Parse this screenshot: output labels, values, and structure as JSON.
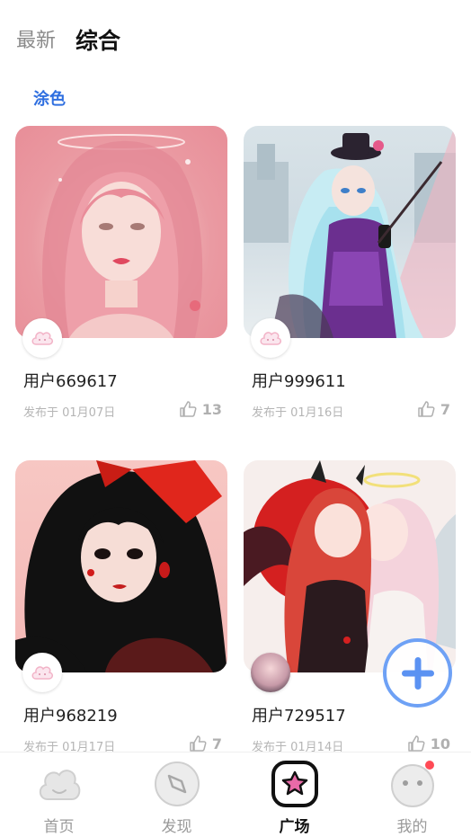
{
  "top_tabs": [
    {
      "label": "最新",
      "active": false
    },
    {
      "label": "综合",
      "active": true
    }
  ],
  "category": "涂色",
  "cards": [
    {
      "user": "用户669617",
      "date": "发布于 01月07日",
      "likes": "13"
    },
    {
      "user": "用户999611",
      "date": "发布于 01月16日",
      "likes": "7"
    },
    {
      "user": "用户968219",
      "date": "发布于 01月17日",
      "likes": "7"
    },
    {
      "user": "用户729517",
      "date": "发布于 01月14日",
      "likes": "10"
    }
  ],
  "fab_icon": "plus-icon",
  "bottom_nav": [
    {
      "label": "首页",
      "icon": "cloud-home-icon",
      "active": false
    },
    {
      "label": "发现",
      "icon": "compass-icon",
      "active": false
    },
    {
      "label": "广场",
      "icon": "flower-square-icon",
      "active": true
    },
    {
      "label": "我的",
      "icon": "face-profile-icon",
      "active": false,
      "badge": true
    }
  ],
  "colors": {
    "accent": "#2f6fe0",
    "fab_border": "#6ea1f5",
    "badge": "#ff4a55",
    "active_nav_icon": "#e96aa8"
  }
}
